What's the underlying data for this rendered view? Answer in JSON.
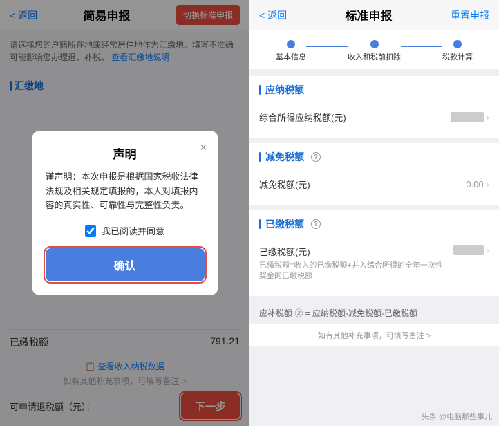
{
  "left": {
    "back_label": "< 返回",
    "title": "简易申报",
    "switch_btn_label": "切换标准申报",
    "hint_text": "请选择您的户籍所在地或经常居住地作为汇缴地。填写不准确可能影响您办理退、补税。",
    "hint_link": "查看汇缴地说明",
    "section_label": "汇缴地",
    "modal": {
      "title": "声明",
      "close_label": "×",
      "body": "谨声明：本次申报是根据国家税收法律法规及相关规定填报的，本人对填报内容的真实性、可靠性与完整性负责。",
      "checkbox_label": "我已阅读并同意",
      "confirm_label": "确认"
    },
    "paid_tax_label": "已缴税额",
    "paid_tax_value": "791.21",
    "view_data_link": "查看收入纳税数据",
    "note_link": "如有其他补充事项，可填写备注 >",
    "refund_label": "可申请退税额（元）：",
    "next_btn_label": "下一步"
  },
  "right": {
    "back_label": "< 返回",
    "title": "标准申报",
    "reset_btn_label": "重置申报",
    "steps": [
      {
        "label": "基本信息",
        "active": false
      },
      {
        "label": "收入和税前扣除",
        "active": false
      },
      {
        "label": "税款计算",
        "active": true
      }
    ],
    "sections": [
      {
        "id": "taxable",
        "title": "应纳税额",
        "rows": [
          {
            "label": "综合所得应纳税额(元)",
            "value": "██████",
            "blurred": true
          }
        ]
      },
      {
        "id": "reduction",
        "title": "减免税额",
        "has_question": true,
        "rows": [
          {
            "label": "减免税额(元)",
            "value": "0.00"
          }
        ]
      },
      {
        "id": "paid",
        "title": "已缴税额",
        "has_question": true,
        "rows": [
          {
            "label": "已缴税额(元)",
            "sub_desc": "已缴税额=收入的已缴税额+并入综合所得的全年一次性奖金的已缴税额",
            "value": "██████",
            "blurred": true
          }
        ]
      }
    ],
    "formula_text": "应补税额 ② = 应纳税额-减免税额-已缴税额",
    "bottom_note": "如有其他补充事项，可填写备注 >",
    "watermark": "头条 @电脑那些事儿"
  }
}
